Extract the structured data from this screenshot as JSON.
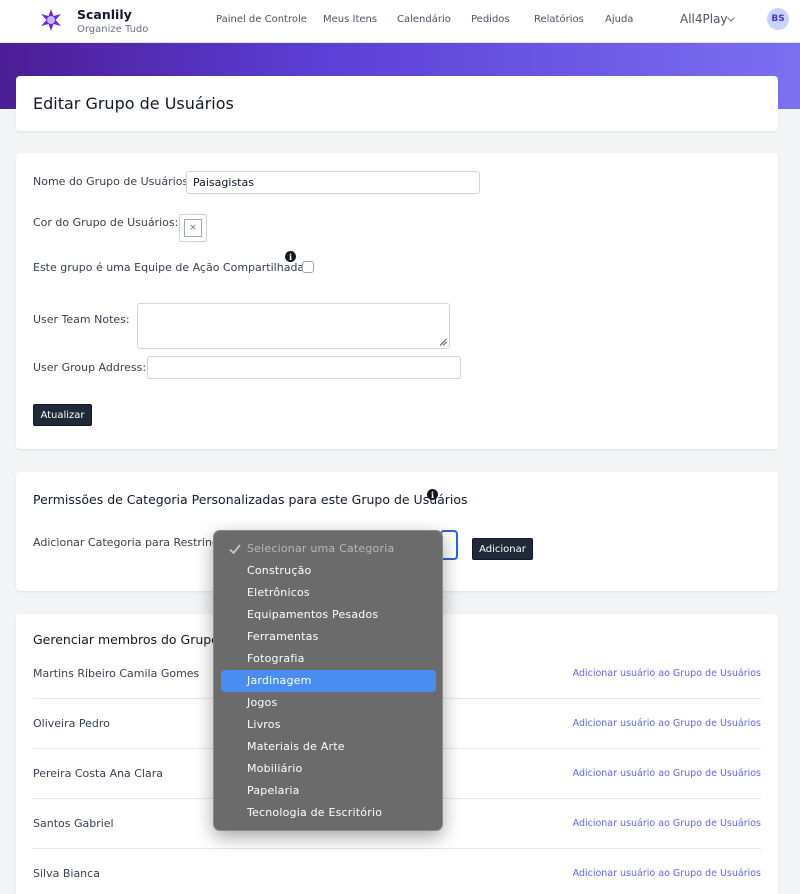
{
  "brand": {
    "name": "Scanlily",
    "tagline": "Organize Tudo"
  },
  "nav": [
    {
      "label": "Painel de Controle"
    },
    {
      "label": "Meus Itens"
    },
    {
      "label": "Calendário"
    },
    {
      "label": "Pedidos"
    },
    {
      "label": "Relatórios"
    },
    {
      "label": "Ajuda"
    }
  ],
  "account": {
    "name": "All4Play",
    "initials": "BS"
  },
  "page": {
    "title": "Editar Grupo de Usuários"
  },
  "form": {
    "name_label": "Nome do Grupo de Usuários:",
    "name_value": "Paisagistas",
    "color_label": "Cor do Grupo de Usuários:",
    "color_placeholder": "×",
    "shared_label": "Este grupo é uma Equipe de Ação Compartilhada?",
    "notes_label": "User Team Notes:",
    "address_label": "User Group Address:",
    "update_button": "Atualizar"
  },
  "permissions": {
    "title": "Permissões de Categoria Personalizadas para este Grupo de Usuários",
    "restrict_label": "Adicionar Categoria para Restringir:",
    "add_button": "Adicionar",
    "options": [
      {
        "label": "Selecionar uma Categoria",
        "disabled": true
      },
      {
        "label": "Construção"
      },
      {
        "label": "Eletrônicos"
      },
      {
        "label": "Equipamentos Pesados"
      },
      {
        "label": "Ferramentas"
      },
      {
        "label": "Fotografia"
      },
      {
        "label": "Jardinagem",
        "highlighted": true
      },
      {
        "label": "Jogos"
      },
      {
        "label": "Livros"
      },
      {
        "label": "Materiais de Arte"
      },
      {
        "label": "Mobiliário"
      },
      {
        "label": "Papelaria"
      },
      {
        "label": "Tecnologia de Escritório"
      }
    ]
  },
  "members": {
    "title": "Gerenciar membros do Grupo d",
    "add_link": "Adicionar usuário ao Grupo de Usuários",
    "rows": [
      {
        "name": "Martins Ribeiro Camila Gomes"
      },
      {
        "name": "Oliveira Pedro"
      },
      {
        "name": "Pereira Costa Ana Clara"
      },
      {
        "name": "Santos Gabriel"
      },
      {
        "name": "Silva Bianca"
      }
    ]
  },
  "colors": {
    "accent": "#4a8df0",
    "brand": "#4c1d95",
    "link": "#6366f1",
    "button": "#1f2937"
  }
}
